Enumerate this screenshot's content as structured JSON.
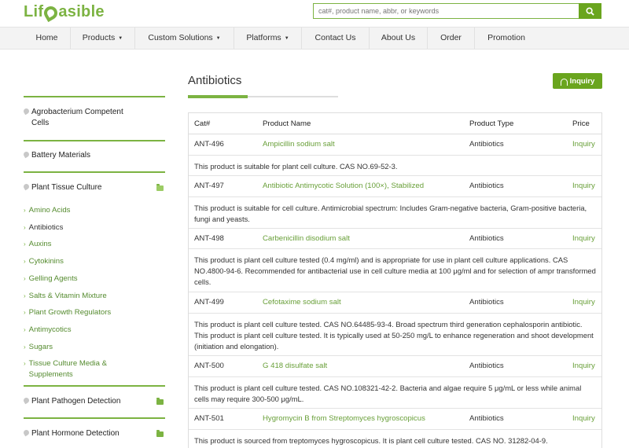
{
  "header": {
    "logo_prefix": "Lif",
    "logo_suffix": "asible",
    "search_placeholder": "cat#, product name, abbr, or keywords"
  },
  "nav": {
    "items": [
      {
        "label": "Home",
        "dropdown": false
      },
      {
        "label": "Products",
        "dropdown": true
      },
      {
        "label": "Custom Solutions",
        "dropdown": true
      },
      {
        "label": "Platforms",
        "dropdown": true
      },
      {
        "label": "Contact Us",
        "dropdown": false
      },
      {
        "label": "About Us",
        "dropdown": false
      },
      {
        "label": "Order",
        "dropdown": false
      },
      {
        "label": "Promotion",
        "dropdown": false
      }
    ],
    "caret": "▼"
  },
  "sidebar": {
    "categories": [
      {
        "label": "Agrobacterium Competent Cells"
      },
      {
        "label": "Battery Materials"
      },
      {
        "label": "Plant Tissue Culture"
      },
      {
        "label": "Plant Pathogen Detection"
      },
      {
        "label": "Plant Hormone Detection"
      }
    ],
    "subitems": [
      {
        "label": "Amino Acids"
      },
      {
        "label": "Antibiotics"
      },
      {
        "label": "Auxins"
      },
      {
        "label": "Cytokinins"
      },
      {
        "label": "Gelling Agents"
      },
      {
        "label": "Salts & Vitamin Mixture"
      },
      {
        "label": "Plant Growth Regulators"
      },
      {
        "label": "Antimycotics"
      },
      {
        "label": "Sugars"
      },
      {
        "label": "Tissue Culture Media & Supplements"
      }
    ],
    "chevron": "›"
  },
  "main": {
    "title": "Antibiotics",
    "inquiry_label": "Inquiry",
    "table": {
      "headers": {
        "cat": "Cat#",
        "name": "Product Name",
        "type": "Product Type",
        "price": "Price"
      },
      "rows": [
        {
          "cat": "ANT-496",
          "name": "Ampicillin sodium salt",
          "type": "Antibiotics",
          "price": "Inquiry",
          "desc": "This product is suitable for plant cell culture. CAS NO.69-52-3."
        },
        {
          "cat": "ANT-497",
          "name": "Antibiotic Antimycotic Solution (100×), Stabilized",
          "type": "Antibiotics",
          "price": "Inquiry",
          "desc": "This product is suitable for cell culture. Antimicrobial spectrum: Includes Gram-negative bacteria, Gram-positive bacteria, fungi and yeasts."
        },
        {
          "cat": "ANT-498",
          "name": "Carbenicillin disodium salt",
          "type": "Antibiotics",
          "price": "Inquiry",
          "desc": "This product is plant cell culture tested (0.4 mg/ml) and is appropriate for use in plant cell culture applications. CAS NO.4800-94-6. Recommended for antibacterial use in cell culture media at 100 μg/ml and for selection of ampr transformed cells."
        },
        {
          "cat": "ANT-499",
          "name": "Cefotaxime sodium salt",
          "type": "Antibiotics",
          "price": "Inquiry",
          "desc": "This product is plant cell culture tested. CAS NO.64485-93-4. Broad spectrum third generation cephalosporin antibiotic. This product is plant cell culture tested. It is typically used at 50-250 mg/L to enhance regeneration and shoot development (initiation and elongation)."
        },
        {
          "cat": "ANT-500",
          "name": "G 418 disulfate salt",
          "type": "Antibiotics",
          "price": "Inquiry",
          "desc": "This product is plant cell culture tested. CAS NO.108321-42-2. Bacteria and algae require 5 μg/mL or less while animal cells may require 300-500 μg/mL."
        },
        {
          "cat": "ANT-501",
          "name": "Hygromycin B from Streptomyces hygroscopicus",
          "type": "Antibiotics",
          "price": "Inquiry",
          "desc": "This product is sourced from treptomyces hygroscopicus. It is plant cell culture tested. CAS NO. 31282-04-9."
        }
      ]
    }
  },
  "colors": {
    "accent": "#7cb342",
    "button": "#6aa51e",
    "link": "#689f38"
  }
}
